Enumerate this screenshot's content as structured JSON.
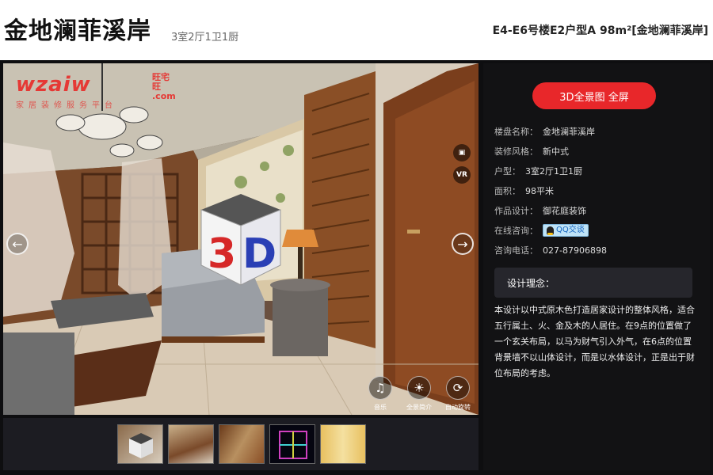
{
  "header": {
    "title": "金地澜菲溪岸",
    "layout_summary": "3室2厅1卫1厨",
    "unit_title": "E4-E6号楼E2户型A 98m²[金地澜菲溪岸]"
  },
  "viewer": {
    "logo_main": "wzaiw",
    "logo_side_1": "旺宅旺",
    "logo_side_2": ".com",
    "logo_sub": "家居装修服务平台",
    "side_vr_label": "VR",
    "prev_arrow": "←",
    "next_arrow": "→",
    "controls": [
      {
        "icon": "music-note-icon",
        "glyph": "♫",
        "label": "音乐"
      },
      {
        "icon": "lightbulb-icon",
        "glyph": "☀",
        "label": "全景简介"
      },
      {
        "icon": "rotate-icon",
        "glyph": "⟳",
        "label": "自动旋转"
      }
    ]
  },
  "panel": {
    "fullscreen_button": "3D全景图 全屏",
    "rows": {
      "building_key": "楼盘名称：",
      "building_val": "金地澜菲溪岸",
      "style_key": "装修风格：",
      "style_val": "新中式",
      "layout_key": "户型：",
      "layout_val": "3室2厅1卫1厨",
      "area_key": "面积：",
      "area_val": "98平米",
      "designer_key": "作品设计：",
      "designer_val": "御花庭装饰",
      "consult_key": "在线咨询：",
      "consult_btn": "QQ交谈",
      "phone_key": "咨询电话：",
      "phone_val": "027-87906898"
    },
    "concept_heading": "设计理念：",
    "concept_text": "本设计以中式原木色打造居家设计的整体风格，适合五行属土、火、金及木的人居住。在9点的位置做了一个玄关布局，以马为财气引入外气，在6点的位置背景墙不以山体设计，而是以水体设计，正是出于财位布局的考虑。"
  },
  "colors": {
    "accent": "#e8272a",
    "panel_bg": "#121214",
    "logo": "#e53935"
  }
}
